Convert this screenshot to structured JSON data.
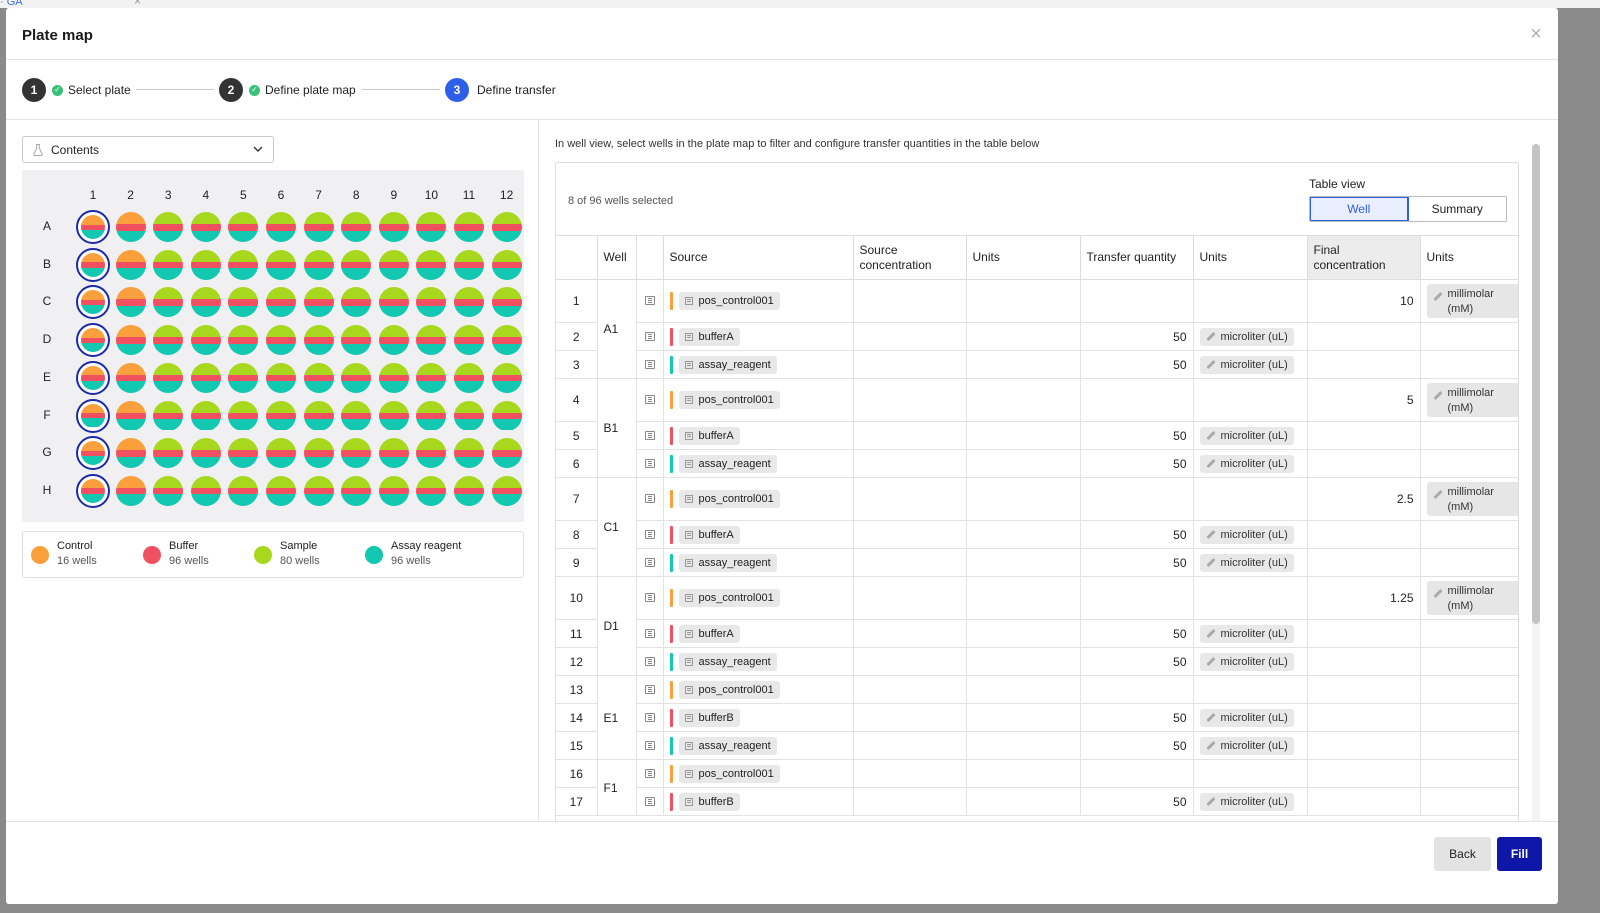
{
  "background": {
    "link_text": "· GA"
  },
  "modal": {
    "title": "Plate map"
  },
  "stepper": {
    "steps": [
      {
        "number": "1",
        "label": "Select plate",
        "status": "complete"
      },
      {
        "number": "2",
        "label": "Define plate map",
        "status": "complete"
      },
      {
        "number": "3",
        "label": "Define transfer",
        "status": "active"
      }
    ]
  },
  "left": {
    "contents_select": {
      "value": "Contents",
      "icon": "flask-icon"
    },
    "plate": {
      "columns": [
        "1",
        "2",
        "3",
        "4",
        "5",
        "6",
        "7",
        "8",
        "9",
        "10",
        "11",
        "12"
      ],
      "rows": [
        "A",
        "B",
        "C",
        "D",
        "E",
        "F",
        "G",
        "H"
      ],
      "selected_column": "1",
      "colors": {
        "control": "#f9a03c",
        "buffer": "#f05060",
        "sample": "#a8d81e",
        "assay": "#12c8b0",
        "selection": "#1a2aa8"
      }
    },
    "legend": [
      {
        "name": "Control",
        "count": "16 wells",
        "color": "#f9a03c"
      },
      {
        "name": "Buffer",
        "count": "96 wells",
        "color": "#f05060"
      },
      {
        "name": "Sample",
        "count": "80 wells",
        "color": "#a8d81e"
      },
      {
        "name": "Assay reagent",
        "count": "96 wells",
        "color": "#12c8b0"
      }
    ]
  },
  "right": {
    "instruction": "In well view, select wells in the plate map to filter and configure transfer quantities in the table below",
    "selected_count": "8 of 96 wells selected",
    "table_view": {
      "label": "Table view",
      "options": [
        "Well",
        "Summary"
      ],
      "selected": "Well"
    },
    "table": {
      "headers": [
        "",
        "Well",
        "",
        "Source",
        "Source concentration",
        "Units",
        "Transfer quantity",
        "Units",
        "Final concentration",
        "Units"
      ],
      "rows": [
        {
          "n": "1",
          "well": "A1",
          "source": "pos_control001",
          "color": "#f9a03c",
          "qty": "",
          "qty_unit": "",
          "final": "10",
          "final_unit": [
            "millimolar",
            "(mM)"
          ]
        },
        {
          "n": "2",
          "well": "",
          "source": "bufferA",
          "color": "#f05060",
          "qty": "50",
          "qty_unit": "microliter (uL)",
          "final": "",
          "final_unit": []
        },
        {
          "n": "3",
          "well": "",
          "source": "assay_reagent",
          "color": "#12c8b0",
          "qty": "50",
          "qty_unit": "microliter (uL)",
          "final": "",
          "final_unit": []
        },
        {
          "n": "4",
          "well": "B1",
          "source": "pos_control001",
          "color": "#f9a03c",
          "qty": "",
          "qty_unit": "",
          "final": "5",
          "final_unit": [
            "millimolar",
            "(mM)"
          ]
        },
        {
          "n": "5",
          "well": "",
          "source": "bufferA",
          "color": "#f05060",
          "qty": "50",
          "qty_unit": "microliter (uL)",
          "final": "",
          "final_unit": []
        },
        {
          "n": "6",
          "well": "",
          "source": "assay_reagent",
          "color": "#12c8b0",
          "qty": "50",
          "qty_unit": "microliter (uL)",
          "final": "",
          "final_unit": []
        },
        {
          "n": "7",
          "well": "C1",
          "source": "pos_control001",
          "color": "#f9a03c",
          "qty": "",
          "qty_unit": "",
          "final": "2.5",
          "final_unit": [
            "millimolar",
            "(mM)"
          ]
        },
        {
          "n": "8",
          "well": "",
          "source": "bufferA",
          "color": "#f05060",
          "qty": "50",
          "qty_unit": "microliter (uL)",
          "final": "",
          "final_unit": []
        },
        {
          "n": "9",
          "well": "",
          "source": "assay_reagent",
          "color": "#12c8b0",
          "qty": "50",
          "qty_unit": "microliter (uL)",
          "final": "",
          "final_unit": []
        },
        {
          "n": "10",
          "well": "D1",
          "source": "pos_control001",
          "color": "#f9a03c",
          "qty": "",
          "qty_unit": "",
          "final": "1.25",
          "final_unit": [
            "millimolar",
            "(mM)"
          ]
        },
        {
          "n": "11",
          "well": "",
          "source": "bufferA",
          "color": "#f05060",
          "qty": "50",
          "qty_unit": "microliter (uL)",
          "final": "",
          "final_unit": []
        },
        {
          "n": "12",
          "well": "",
          "source": "assay_reagent",
          "color": "#12c8b0",
          "qty": "50",
          "qty_unit": "microliter (uL)",
          "final": "",
          "final_unit": []
        },
        {
          "n": "13",
          "well": "E1",
          "source": "pos_control001",
          "color": "#f9a03c",
          "qty": "",
          "qty_unit": "",
          "final": "",
          "final_unit": []
        },
        {
          "n": "14",
          "well": "",
          "source": "bufferB",
          "color": "#f05060",
          "qty": "50",
          "qty_unit": "microliter (uL)",
          "final": "",
          "final_unit": []
        },
        {
          "n": "15",
          "well": "",
          "source": "assay_reagent",
          "color": "#12c8b0",
          "qty": "50",
          "qty_unit": "microliter (uL)",
          "final": "",
          "final_unit": []
        },
        {
          "n": "16",
          "well": "F1",
          "source": "pos_control001",
          "color": "#f9a03c",
          "qty": "",
          "qty_unit": "",
          "final": "",
          "final_unit": []
        },
        {
          "n": "17",
          "well": "",
          "source": "bufferB",
          "color": "#f05060",
          "qty": "50",
          "qty_unit": "microliter (uL)",
          "final": "",
          "final_unit": []
        }
      ]
    }
  },
  "footer": {
    "back_label": "Back",
    "fill_label": "Fill"
  }
}
